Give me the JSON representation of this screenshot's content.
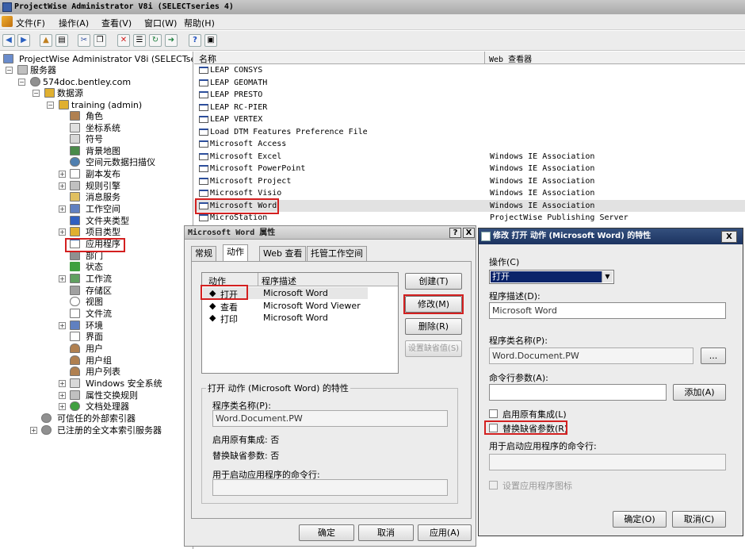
{
  "window": {
    "title": "ProjectWise Administrator V8i (SELECTseries 4)"
  },
  "menu": [
    "文件(F)",
    "操作(A)",
    "查看(V)",
    "窗口(W)",
    "帮助(H)"
  ],
  "tree": {
    "root": "ProjectWise Administrator V8i (SELECTser",
    "servers": "服务器",
    "host": "574doc.bentley.com",
    "datasources": "数据源",
    "datasource": "training (admin)",
    "children": [
      "角色",
      "坐标系统",
      "符号",
      "背景地图",
      "空间元数据扫描仪",
      "副本发布",
      "规则引擎",
      "消息服务",
      "工作空间",
      "文件夹类型",
      "项目类型",
      "应用程序",
      "部门",
      "状态",
      "工作流",
      "存储区",
      "视图",
      "文件流",
      "环境",
      "界面",
      "用户",
      "用户组",
      "用户列表",
      "Windows 安全系统",
      "属性交换规则",
      "文档处理器"
    ],
    "trusted": "可信任的外部索引器",
    "registered": "已注册的全文本索引服务器"
  },
  "list": {
    "columns": [
      "名称",
      "Web 查看器"
    ],
    "rows": [
      {
        "name": "LEAP CONSYS",
        "web": ""
      },
      {
        "name": "LEAP GEOMATH",
        "web": ""
      },
      {
        "name": "LEAP PRESTO",
        "web": ""
      },
      {
        "name": "LEAP RC-PIER",
        "web": ""
      },
      {
        "name": "LEAP VERTEX",
        "web": ""
      },
      {
        "name": "Load DTM Features Preference File",
        "web": ""
      },
      {
        "name": "Microsoft Access",
        "web": ""
      },
      {
        "name": "Microsoft Excel",
        "web": "Windows IE Association"
      },
      {
        "name": "Microsoft PowerPoint",
        "web": "Windows IE Association"
      },
      {
        "name": "Microsoft Project",
        "web": "Windows IE Association"
      },
      {
        "name": "Microsoft Visio",
        "web": "Windows IE Association"
      },
      {
        "name": "Microsoft Word",
        "web": "Windows IE Association"
      },
      {
        "name": "MicroStation",
        "web": "ProjectWise Publishing Server"
      }
    ]
  },
  "dlg1": {
    "title": "Microsoft Word 属性",
    "help": "?",
    "close": "X",
    "tabs": [
      "常规",
      "动作",
      "Web 查看",
      "托管工作空间"
    ],
    "table_headers": [
      "动作",
      "程序描述"
    ],
    "actions": [
      {
        "action": "打开",
        "desc": "Microsoft Word"
      },
      {
        "action": "查看",
        "desc": "Microsoft Word Viewer"
      },
      {
        "action": "打印",
        "desc": "Microsoft Word"
      }
    ],
    "buttons": {
      "create": "创建(T)",
      "modify": "修改(M)",
      "delete": "删除(R)",
      "set_default": "设置缺省值(S)"
    },
    "group_title": "打开 动作 (Microsoft Word) 的特性",
    "class_label": "程序类名称(P):",
    "class_value": "Word.Document.PW",
    "integ_label": "启用原有集成: 否",
    "replace_label": "替换缺省参数: 否",
    "cmdline_label": "用于启动应用程序的命令行:",
    "ok": "确定",
    "cancel": "取消",
    "apply": "应用(A)"
  },
  "dlg2": {
    "title": "修改 打开 动作 (Microsoft Word) 的特性",
    "close": "X",
    "action_label": "操作(C)",
    "action_value": "打开",
    "desc_label": "程序描述(D):",
    "desc_value": "Microsoft Word",
    "class_label": "程序类名称(P):",
    "class_value": "Word.Document.PW",
    "browse": "...",
    "args_label": "命令行参数(A):",
    "add": "添加(A)",
    "cb_integ": "启用原有集成(L)",
    "cb_replace": "替换缺省参数(R)",
    "cmdline_label": "用于启动应用程序的命令行:",
    "cb_icon": "设置应用程序图标",
    "ok": "确定(O)",
    "cancel": "取消(C)"
  }
}
